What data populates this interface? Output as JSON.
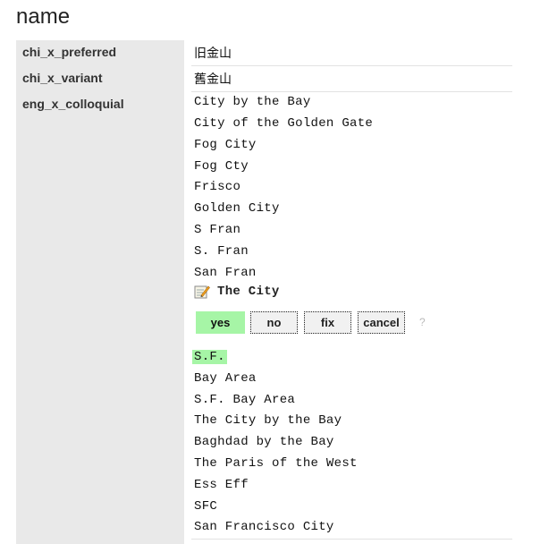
{
  "page": {
    "title": "name"
  },
  "fields": {
    "chi_x_preferred": {
      "key": "chi_x_preferred",
      "value": "旧金山"
    },
    "chi_x_variant": {
      "key": "chi_x_variant",
      "value": "舊金山"
    },
    "eng_x_colloquial": {
      "key": "eng_x_colloquial",
      "values_before": [
        "City by the Bay",
        "City of the Golden Gate",
        "Fog City",
        "Fog Cty",
        "Frisco",
        "Golden City",
        "S Fran",
        "S. Fran",
        "San Fran"
      ],
      "editing": {
        "value": "The City",
        "icon": "edit-note-icon"
      },
      "actions": {
        "yes": "yes",
        "no": "no",
        "fix": "fix",
        "cancel": "cancel",
        "help": "?"
      },
      "values_after": [
        "S.F.",
        "Bay Area",
        "S.F. Bay Area",
        "The City by the Bay",
        "Baghdad by the Bay",
        "The Paris of the West",
        "Ess Eff",
        "SFC",
        "San Francisco City"
      ]
    }
  },
  "colors": {
    "key_column_bg": "#e9e9e9",
    "accept_green": "#a6f5a6"
  }
}
